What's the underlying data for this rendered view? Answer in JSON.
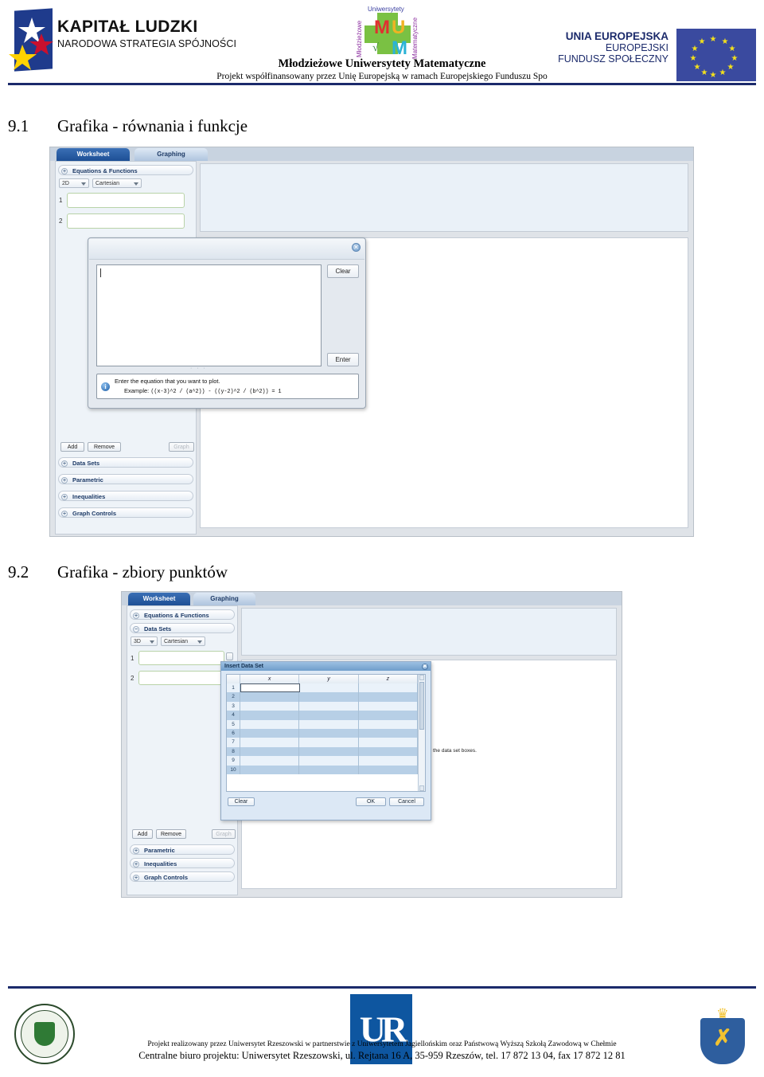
{
  "header": {
    "kapital_title": "KAPITAŁ LUDZKI",
    "kapital_subtitle": "NARODOWA STRATEGIA SPÓJNOŚCI",
    "mum_title": "Młodzieżowe Uniwersytety Matematyczne",
    "mum_subtitle": "Projekt współfinansowany przez Unię Europejską w ramach Europejskiego Funduszu Spo",
    "eu_line1": "UNIA EUROPEJSKA",
    "eu_line2": "EUROPEJSKI",
    "eu_line3": "FUNDUSZ SPOŁECZNY"
  },
  "sections": [
    {
      "number": "9.1",
      "title": "Grafika - równania i funkcje"
    },
    {
      "number": "9.2",
      "title": "Grafika - zbiory punktów"
    }
  ],
  "screenshot_equations": {
    "tabs": [
      {
        "label": "Worksheet",
        "active": true
      },
      {
        "label": "Graphing",
        "active": false
      }
    ],
    "accordions": [
      {
        "label": "Equations & Functions",
        "icon": "plus-circle-icon"
      },
      {
        "label": "Data Sets",
        "icon": "plus-circle-icon"
      },
      {
        "label": "Parametric",
        "icon": "plus-circle-icon"
      },
      {
        "label": "Inequalities",
        "icon": "plus-circle-icon"
      },
      {
        "label": "Graph Controls",
        "icon": "plus-circle-icon"
      }
    ],
    "dropdowns": [
      {
        "value": "2D"
      },
      {
        "value": "Cartesian"
      }
    ],
    "equation_rows": [
      {
        "index": "1",
        "value": ""
      },
      {
        "index": "2",
        "value": ""
      }
    ],
    "buttons": [
      {
        "label": "Add",
        "enabled": true
      },
      {
        "label": "Remove",
        "enabled": true
      },
      {
        "label": "Graph",
        "enabled": false
      }
    ],
    "dialog": {
      "name": "equation-entry-dialog",
      "close_icon": "close-icon",
      "text_value": "",
      "clear_label": "Clear",
      "enter_label": "Enter",
      "info_icon": "info-icon",
      "info_line1": "Enter the equation that you want to plot.",
      "info_line2_label": "Example:",
      "info_line2_code": "((x-3)^2 / (a^2)) - ((y-2)^2 / (b^2)) = 1",
      "resize_dots": "· · ·"
    }
  },
  "screenshot_datasets": {
    "tabs": [
      {
        "label": "Worksheet",
        "active": true
      },
      {
        "label": "Graphing",
        "active": false
      }
    ],
    "accordions_top": [
      {
        "label": "Equations & Functions",
        "icon": "plus-circle-icon"
      },
      {
        "label": "Data Sets",
        "icon": "minus-circle-icon"
      }
    ],
    "accordions_bottom": [
      {
        "label": "Parametric",
        "icon": "plus-circle-icon"
      },
      {
        "label": "Inequalities",
        "icon": "plus-circle-icon"
      },
      {
        "label": "Graph Controls",
        "icon": "plus-circle-icon"
      }
    ],
    "dropdowns": [
      {
        "value": "3D"
      },
      {
        "value": "Cartesian"
      }
    ],
    "dataset_rows": [
      {
        "index": "1",
        "value": ""
      },
      {
        "index": "2",
        "value": ""
      }
    ],
    "buttons": [
      {
        "label": "Add",
        "enabled": true
      },
      {
        "label": "Remove",
        "enabled": true
      },
      {
        "label": "Graph",
        "enabled": false
      }
    ],
    "side_note": "the data set boxes.",
    "dialog": {
      "name": "insert-data-set-dialog",
      "title": "Insert Data Set",
      "close_icon": "close-icon",
      "columns": [
        "x",
        "y",
        "z"
      ],
      "rows": [
        "1",
        "2",
        "3",
        "4",
        "5",
        "6",
        "7",
        "8",
        "9",
        "10"
      ],
      "active_cell": {
        "row": "1",
        "column": "x",
        "value": ""
      },
      "clear_label": "Clear",
      "ok_label": "OK",
      "cancel_label": "Cancel",
      "scrollbar": "vertical-scrollbar"
    }
  },
  "footer": {
    "line1": "Projekt realizowany przez Uniwersytet Rzeszowski w partnerstwie z Uniwersytetem Jagiellońskim oraz Państwową Wyższą Szkołą Zawodową w Chełmie",
    "line2": "Centralne biuro projektu: Uniwersytet Rzeszowski, ul. Rejtana 16 A, 35-959 Rzeszów, tel. 17 872 13 04, fax 17 872 12 81",
    "ur_mark": "UR"
  },
  "colors": {
    "brand_navy": "#1b2a6b",
    "eu_blue": "#3a4a9f",
    "eu_star": "#f4e11b",
    "ur_blue": "#0e56a0",
    "tab_active": "#1d4f95"
  }
}
